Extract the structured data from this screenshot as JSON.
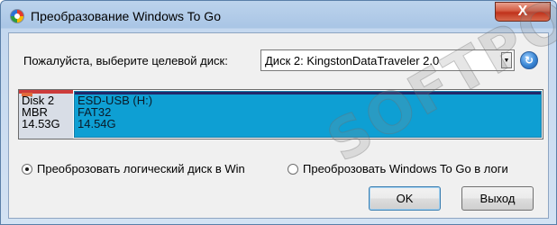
{
  "window": {
    "title": "Преобразование Windows To Go",
    "close_label": "X"
  },
  "disk_selection": {
    "label": "Пожалуйста, выберите целевой диск:",
    "selected": "Диск 2: KingstonDataTraveler 2.0"
  },
  "disk_map": {
    "disk": {
      "name": "Disk 2",
      "style": "MBR",
      "size": "14.53G"
    },
    "partition": {
      "name": "ESD-USB (H:)",
      "filesystem": "FAT32",
      "size": "14.54G",
      "color": "#0e9fd3"
    }
  },
  "options": [
    {
      "label": "Преоброзовать логический диск в Win",
      "checked": true
    },
    {
      "label": "Преоброзовать Windows To Go в логи",
      "checked": false
    }
  ],
  "buttons": {
    "ok": "OK",
    "exit": "Выход"
  },
  "watermark": "SOFTPORTAL"
}
